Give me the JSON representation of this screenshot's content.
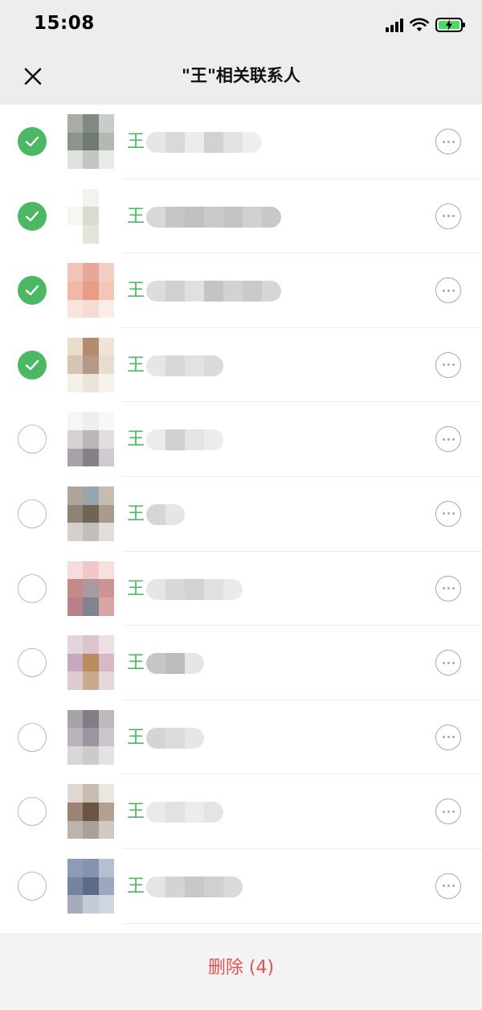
{
  "status_bar": {
    "time": "15:08",
    "icons": [
      "cellular-signal-icon",
      "wifi-icon",
      "battery-charging-icon"
    ]
  },
  "header": {
    "title": "\"王\"相关联系人",
    "close_icon": "close-icon"
  },
  "colors": {
    "accent_green": "#4cb863",
    "delete_red": "#e0534f",
    "header_bg": "#ededed"
  },
  "contacts": [
    {
      "name_visible": "王",
      "selected": true,
      "avatar": [
        "#a8aca4",
        "#7e8a82",
        "#c9ccc8",
        "#8c948c",
        "#6e7a72",
        "#b4b8b2",
        "#dfe1de",
        "#c2c6c1",
        "#e9eae8"
      ],
      "blur": [
        "#e6e6e6",
        "#d9d9d9",
        "#ebebeb",
        "#d2d2d2",
        "#e2e2e2",
        "#efefef"
      ]
    },
    {
      "name_visible": "王",
      "selected": true,
      "avatar": [
        "#ffffff",
        "#f2f2ee",
        "#ffffff",
        "#f6f6f2",
        "#d8dcd0",
        "#ffffff",
        "#ffffff",
        "#e2e6da",
        "#ffffff"
      ],
      "blur": [
        "#d8d8d8",
        "#c6c6c6",
        "#c0c0c0",
        "#cacaca",
        "#c4c4c4",
        "#d0d0d0",
        "#c8c8c8"
      ]
    },
    {
      "name_visible": "王",
      "selected": true,
      "avatar": [
        "#f0c4b8",
        "#e6a89a",
        "#f2cfc4",
        "#f0b8a6",
        "#e99c88",
        "#f4c6b6",
        "#f7e4dc",
        "#f4dcd2",
        "#faece6"
      ],
      "blur": [
        "#dcdcdc",
        "#d0d0d0",
        "#e0e0e0",
        "#c4c4c4",
        "#d2d2d2",
        "#cacaca",
        "#d6d6d6"
      ]
    },
    {
      "name_visible": "王",
      "selected": true,
      "avatar": [
        "#e8dccb",
        "#b48c6c",
        "#eee4d8",
        "#d8c4b0",
        "#b49a86",
        "#e6dccf",
        "#f4efe8",
        "#ece4da",
        "#f6f2ec"
      ],
      "blur": [
        "#e6e6e6",
        "#d8d8d8",
        "#e2e2e2",
        "#dadada"
      ]
    },
    {
      "name_visible": "王",
      "selected": false,
      "avatar": [
        "#f6f6f6",
        "#eeeeee",
        "#f8f8f8",
        "#d6d2d4",
        "#bcb6ba",
        "#e2dee0",
        "#a8a2a8",
        "#888088",
        "#cfcacd"
      ],
      "blur": [
        "#ececec",
        "#d0d0d0",
        "#e4e4e4",
        "#ececec"
      ]
    },
    {
      "name_visible": "王",
      "selected": false,
      "avatar": [
        "#b0a49a",
        "#9aa4ac",
        "#c6bcb2",
        "#8e8274",
        "#6e6458",
        "#a89c8e",
        "#d6d0ca",
        "#c4beb8",
        "#e2ddd8"
      ],
      "blur": [
        "#d6d6d6",
        "#e6e6e6"
      ]
    },
    {
      "name_visible": "王",
      "selected": false,
      "avatar": [
        "#f6dcdc",
        "#f0c8c8",
        "#f8e0e0",
        "#c48a8a",
        "#a89aa0",
        "#cc9494",
        "#b88088",
        "#808490",
        "#d8a4a4"
      ],
      "blur": [
        "#e6e6e6",
        "#d8d8d8",
        "#d2d2d2",
        "#e0e0e0",
        "#eaeaea"
      ]
    },
    {
      "name_visible": "王",
      "selected": false,
      "avatar": [
        "#e4d4dc",
        "#dcc4cc",
        "#ece0e4",
        "#c8a8c0",
        "#b88c5c",
        "#d8b8c8",
        "#dcccd0",
        "#c8aa8c",
        "#e4d8da"
      ],
      "blur": [
        "#c6c6c6",
        "#bcbcbc",
        "#e6e6e6"
      ]
    },
    {
      "name_visible": "王",
      "selected": false,
      "avatar": [
        "#a6a2a8",
        "#847c84",
        "#bdb8bc",
        "#b8b2bc",
        "#9c94a0",
        "#cac4cc",
        "#d8d6d8",
        "#cccacc",
        "#e4e2e4"
      ],
      "blur": [
        "#d4d4d4",
        "#dcdcdc",
        "#e6e6e6"
      ]
    },
    {
      "name_visible": "王",
      "selected": false,
      "avatar": [
        "#e0d8d0",
        "#c8bcb0",
        "#ece6e0",
        "#9c8474",
        "#6c5444",
        "#b4a090",
        "#bcb4ac",
        "#a8a09a",
        "#d0cac4"
      ],
      "blur": [
        "#eaeaea",
        "#e2e2e2",
        "#ececec",
        "#e4e4e4"
      ]
    },
    {
      "name_visible": "王",
      "selected": false,
      "avatar": [
        "#8c9cb4",
        "#8494b0",
        "#b4c0d0",
        "#7484a0",
        "#5c6c88",
        "#9ca8bc",
        "#a4acbc",
        "#c4ccd8",
        "#d0d6e0"
      ],
      "blur": [
        "#e4e4e4",
        "#d4d4d4",
        "#c8c8c8",
        "#d0d0d0",
        "#dadada"
      ]
    }
  ],
  "row_more_icon": "more-icon",
  "footer": {
    "delete_label": "删除 (4)"
  }
}
